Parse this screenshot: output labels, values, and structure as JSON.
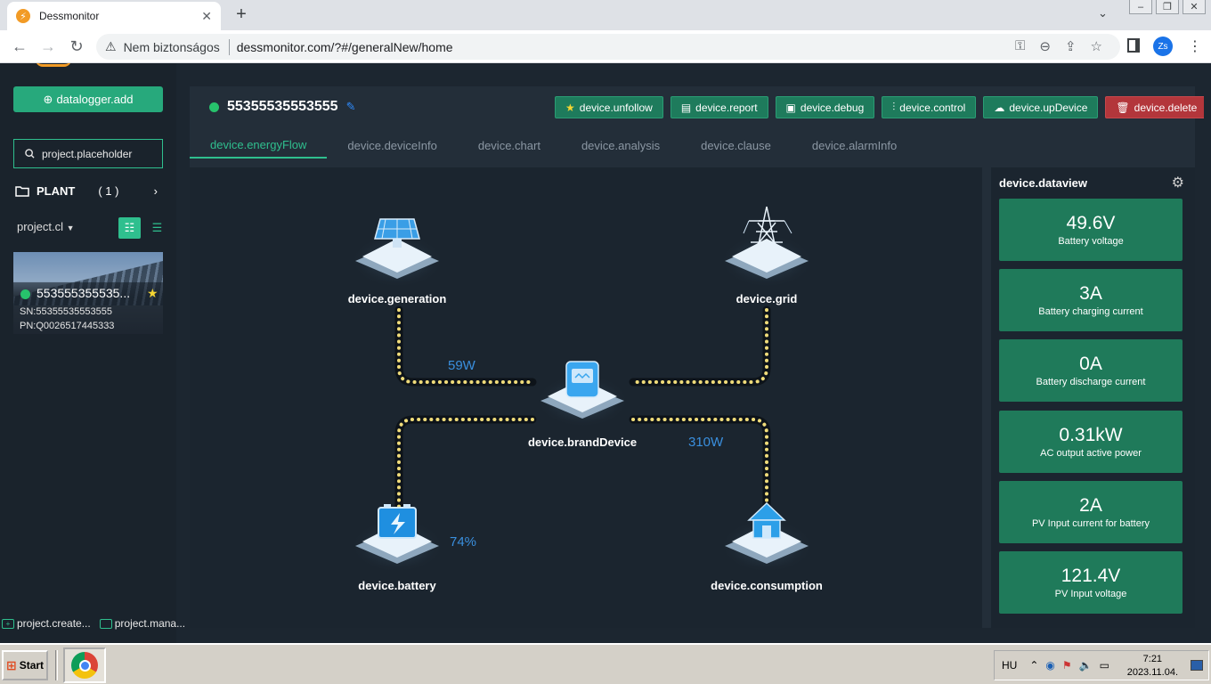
{
  "browser": {
    "tab_title": "Dessmonitor",
    "tab_close": "✕",
    "new_tab": "+",
    "security_label": "Nem biztonságos",
    "url": "dessmonitor.com/?#/generalNew/home",
    "profile_initials": "Zs"
  },
  "sidebar": {
    "add_button": "datalogger.add",
    "search_placeholder": "project.placeholder",
    "plant_label": "PLANT",
    "plant_count": "( 1 )",
    "project_dropdown": "project.cl",
    "plant": {
      "name": "553555355535...",
      "sn": "SN:55355535553555",
      "pn": "PN:Q0026517445333",
      "status_color": "#27c26c"
    },
    "footer": {
      "create": "project.create...",
      "manage": "project.mana..."
    }
  },
  "device": {
    "id": "55355535553555",
    "actions": {
      "unfollow": "device.unfollow",
      "report": "device.report",
      "debug": "device.debug",
      "control": "device.control",
      "upDevice": "device.upDevice",
      "delete": "device.delete"
    },
    "tabs": [
      "device.energyFlow",
      "device.deviceInfo",
      "device.chart",
      "device.analysis",
      "device.clause",
      "device.alarmInfo"
    ],
    "active_tab": "device.energyFlow"
  },
  "flow": {
    "generation_label": "device.generation",
    "grid_label": "device.grid",
    "brand_label": "device.brandDevice",
    "battery_label": "device.battery",
    "consumption_label": "device.consumption",
    "pv_power": "59W",
    "load_power": "310W",
    "battery_soc": "74%"
  },
  "dataview": {
    "title": "device.dataview",
    "cards": [
      {
        "value": "49.6V",
        "label": "Battery voltage"
      },
      {
        "value": "3A",
        "label": "Battery charging current"
      },
      {
        "value": "0A",
        "label": "Battery discharge current"
      },
      {
        "value": "0.31kW",
        "label": "AC output active power"
      },
      {
        "value": "2A",
        "label": "PV Input current for battery"
      },
      {
        "value": "121.4V",
        "label": "PV Input voltage"
      }
    ]
  },
  "taskbar": {
    "start": "Start",
    "lang": "HU",
    "time": "7:21",
    "date": "2023.11.04."
  },
  "colors": {
    "accent": "#2fbf8e",
    "card": "#1f7a5a",
    "danger": "#b3363b",
    "flow_value": "#3a8fde"
  }
}
